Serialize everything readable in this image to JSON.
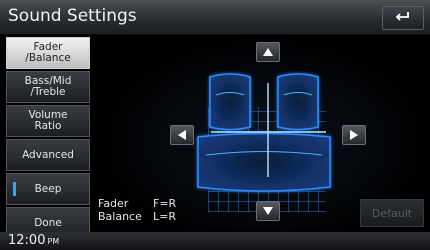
{
  "header": {
    "title": "Sound Settings",
    "back_icon": "back-return-icon"
  },
  "menu": {
    "items": [
      {
        "label": "Fader\n/Balance",
        "selected": true
      },
      {
        "label": "Bass/Mid\n/Treble"
      },
      {
        "label": "Volume\nRatio"
      },
      {
        "label": "Advanced"
      },
      {
        "label": "Beep",
        "indicator_color": "#2aa7ff"
      },
      {
        "label": "Done"
      }
    ]
  },
  "status": {
    "fader_label": "Fader",
    "fader_value": "F=R",
    "balance_label": "Balance",
    "balance_value": "L=R"
  },
  "buttons": {
    "default_label": "Default"
  },
  "footer": {
    "time": "12:00",
    "ampm": "PM"
  },
  "colors": {
    "accent": "#2aa7ff",
    "seat_glow": "#2e8cff"
  }
}
